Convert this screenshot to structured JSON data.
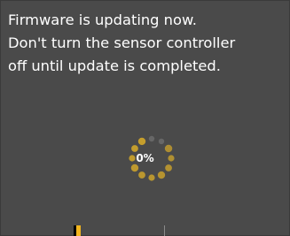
{
  "message": {
    "lines": [
      "Firmware is updating now.",
      "Don't turn the sensor controller",
      "off until update is completed."
    ]
  },
  "progress": {
    "percent_label": "0%",
    "value": 0
  },
  "colors": {
    "background": "#4a4a4a",
    "text": "#ffffff",
    "spinner_active": "#c8a02c",
    "spinner_inactive": "#6e6e6e",
    "progress_accent": "#f2b51f"
  },
  "icons": {
    "spinner": "loading-spinner-icon"
  }
}
